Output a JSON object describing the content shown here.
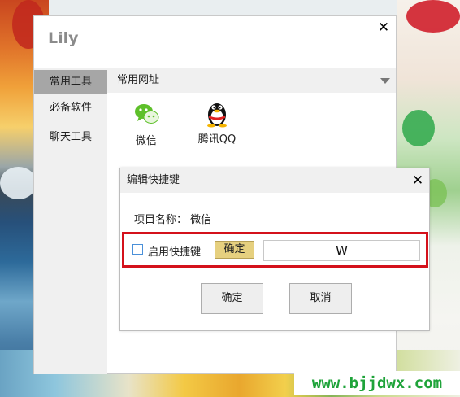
{
  "window": {
    "title": "Lily",
    "close_symbol": "✕"
  },
  "sidebar": {
    "items": [
      {
        "label": "常用工具",
        "active": true
      },
      {
        "label": "必备软件",
        "active": false
      },
      {
        "label": "聊天工具",
        "active": false
      }
    ]
  },
  "category": {
    "label": "常用网址"
  },
  "apps": [
    {
      "label": "微信",
      "icon": "wechat-icon"
    },
    {
      "label": "腾讯QQ",
      "icon": "qq-penguin-icon"
    }
  ],
  "dialog": {
    "title": "编辑快捷键",
    "close_symbol": "✕",
    "item_name": "项目名称： 微信",
    "enable_label": "启用快捷键",
    "inline_confirm": "确定",
    "key_value": "W",
    "ok_label": "确定",
    "cancel_label": "取消"
  },
  "watermark": "www.bjjdwx.com",
  "colors": {
    "highlight_border": "#d4111b",
    "sidebar_active": "#a6a6a6",
    "inline_button": "#e6d07f",
    "watermark_text": "#1fa33a"
  }
}
